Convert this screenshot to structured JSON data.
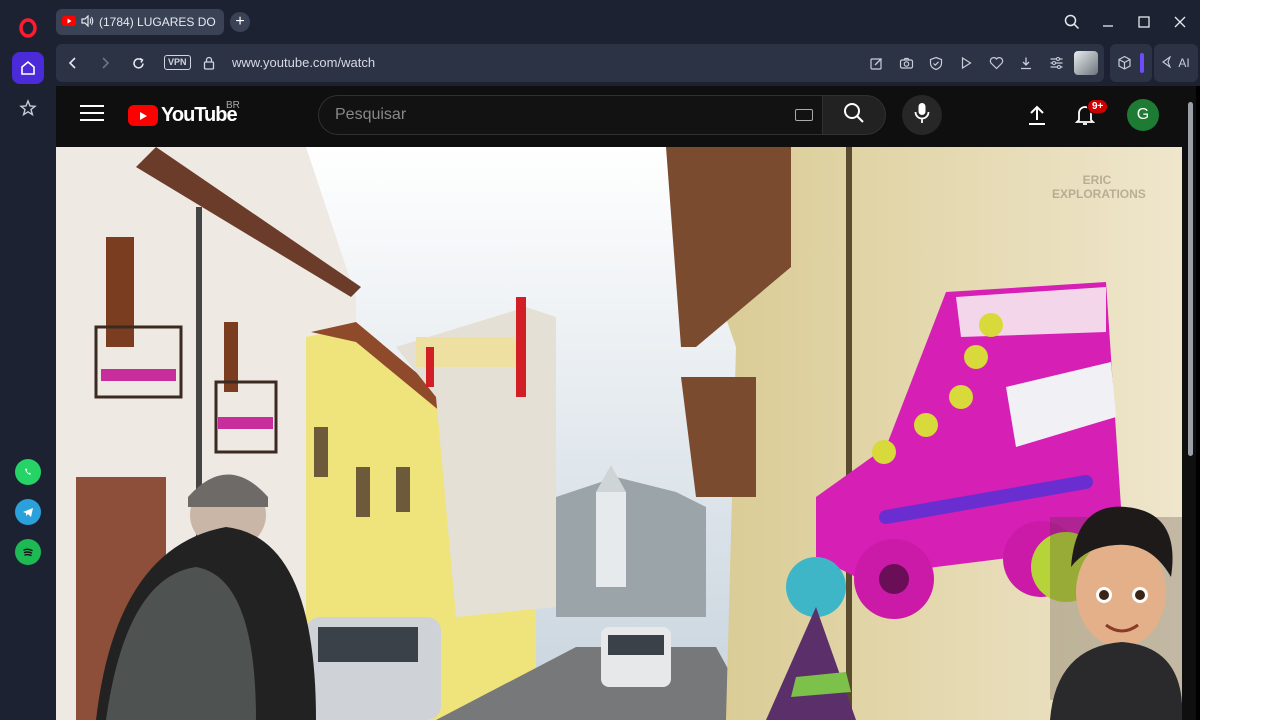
{
  "browser": {
    "tab": {
      "title": "(1784) LUGARES DO P..."
    },
    "new_tab_label": "+",
    "address": {
      "url": "www.youtube.com/watch",
      "vpn_label": "VPN"
    },
    "ai_label": "AI"
  },
  "youtube": {
    "logo_text": "YouTube",
    "country_code": "BR",
    "search": {
      "placeholder": "Pesquisar"
    },
    "notifications": {
      "count_label": "9+"
    },
    "avatar_letter": "G"
  },
  "video": {
    "watermark": "ERIC EXPLORATIONS"
  },
  "colors": {
    "sidebar_bg": "#1d2232",
    "opera_red": "#ff1b2d",
    "sidebar_active": "#4b2bd9",
    "yt_red": "#ff0000",
    "yt_bg": "#0f0f0f",
    "avatar_green": "#1e7b34",
    "whatsapp": "#25d366",
    "telegram": "#2aa1da",
    "spotify": "#1db954"
  }
}
